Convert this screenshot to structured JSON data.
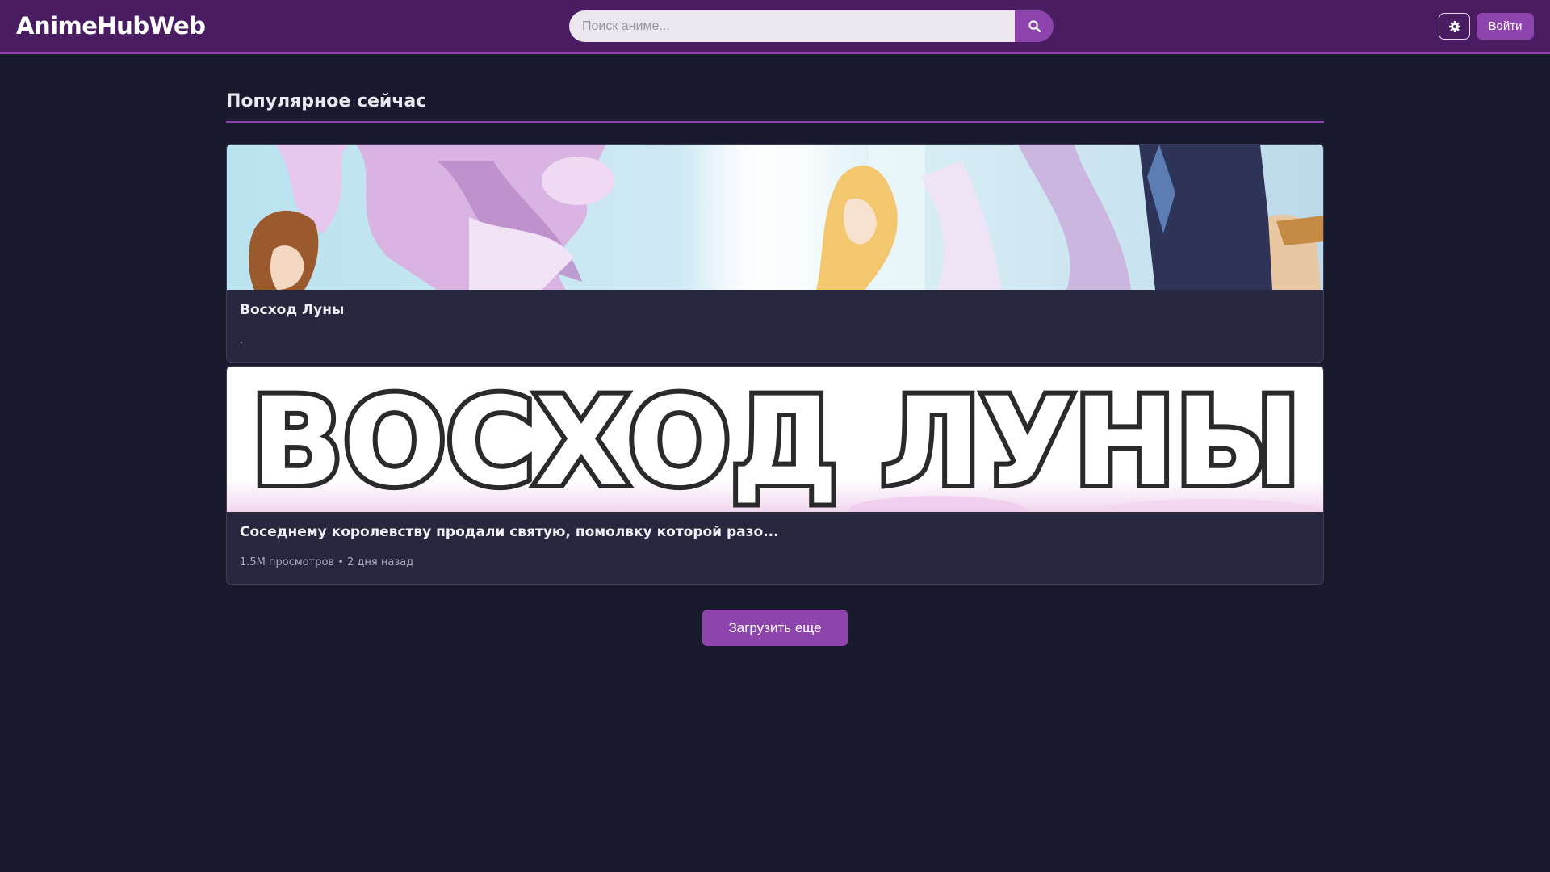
{
  "header": {
    "logo": "AnimeHubWeb",
    "search": {
      "placeholder": "Поиск аниме...",
      "icon": "search-icon"
    },
    "theme_toggle_icon": "gear-icon",
    "login_label": "Войти"
  },
  "main": {
    "section_title": "Популярное сейчас",
    "cards": [
      {
        "title": "Восход Луны",
        "meta": "."
      },
      {
        "title": "Соседнему королевству продали святую, помолвку которой разо...",
        "meta": "1.5M просмотров • 2 дня назад",
        "banner_text": "ВОСХОД ЛУНЫ"
      }
    ],
    "load_more_label": "Загрузить еще"
  },
  "colors": {
    "background": "#1a1a2e",
    "header": "#4a1d62",
    "accent": "#8e44ad",
    "card": "#272740"
  }
}
